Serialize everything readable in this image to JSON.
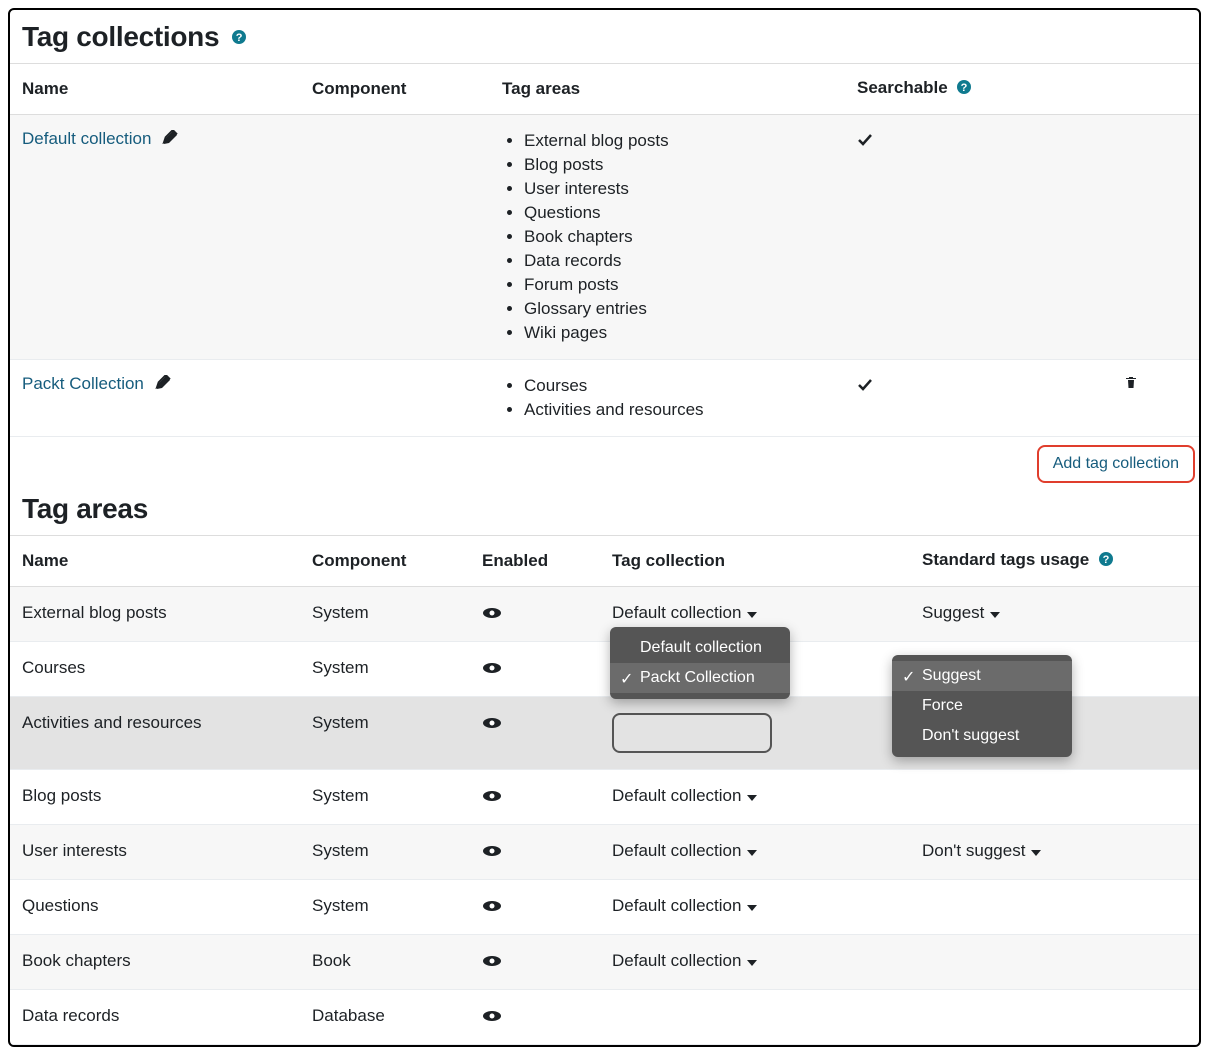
{
  "section1": {
    "title": "Tag collections",
    "headers": {
      "name": "Name",
      "component": "Component",
      "tagareas": "Tag areas",
      "searchable": "Searchable"
    },
    "rows": [
      {
        "name": "Default collection",
        "component": "",
        "areas": [
          "External blog posts",
          "Blog posts",
          "User interests",
          "Questions",
          "Book chapters",
          "Data records",
          "Forum posts",
          "Glossary entries",
          "Wiki pages"
        ],
        "searchable": true,
        "deletable": false
      },
      {
        "name": "Packt Collection",
        "component": "",
        "areas": [
          "Courses",
          "Activities and resources"
        ],
        "searchable": true,
        "deletable": true
      }
    ],
    "add_button": "Add tag collection"
  },
  "section2": {
    "title": "Tag areas",
    "headers": {
      "name": "Name",
      "component": "Component",
      "enabled": "Enabled",
      "tagcollection": "Tag collection",
      "stdtags": "Standard tags usage"
    },
    "rows": [
      {
        "name": "External blog posts",
        "component": "System",
        "collection": "Default collection",
        "std": "Suggest"
      },
      {
        "name": "Courses",
        "component": "System",
        "collection": "Packt Collection",
        "std": "Suggest"
      },
      {
        "name": "Activities and resources",
        "component": "System",
        "collection": "",
        "std": ""
      },
      {
        "name": "Blog posts",
        "component": "System",
        "collection": "Default collection",
        "std": ""
      },
      {
        "name": "User interests",
        "component": "System",
        "collection": "Default collection",
        "std": "Don't suggest"
      },
      {
        "name": "Questions",
        "component": "System",
        "collection": "Default collection",
        "std": ""
      },
      {
        "name": "Book chapters",
        "component": "Book",
        "collection": "Default collection",
        "std": ""
      },
      {
        "name": "Data records",
        "component": "Database",
        "collection": "",
        "std": ""
      }
    ],
    "collection_menu": {
      "options": [
        "Default collection",
        "Packt Collection"
      ],
      "selected": "Packt Collection"
    },
    "std_menu": {
      "options": [
        "Suggest",
        "Force",
        "Don't suggest"
      ],
      "selected": "Suggest"
    }
  }
}
